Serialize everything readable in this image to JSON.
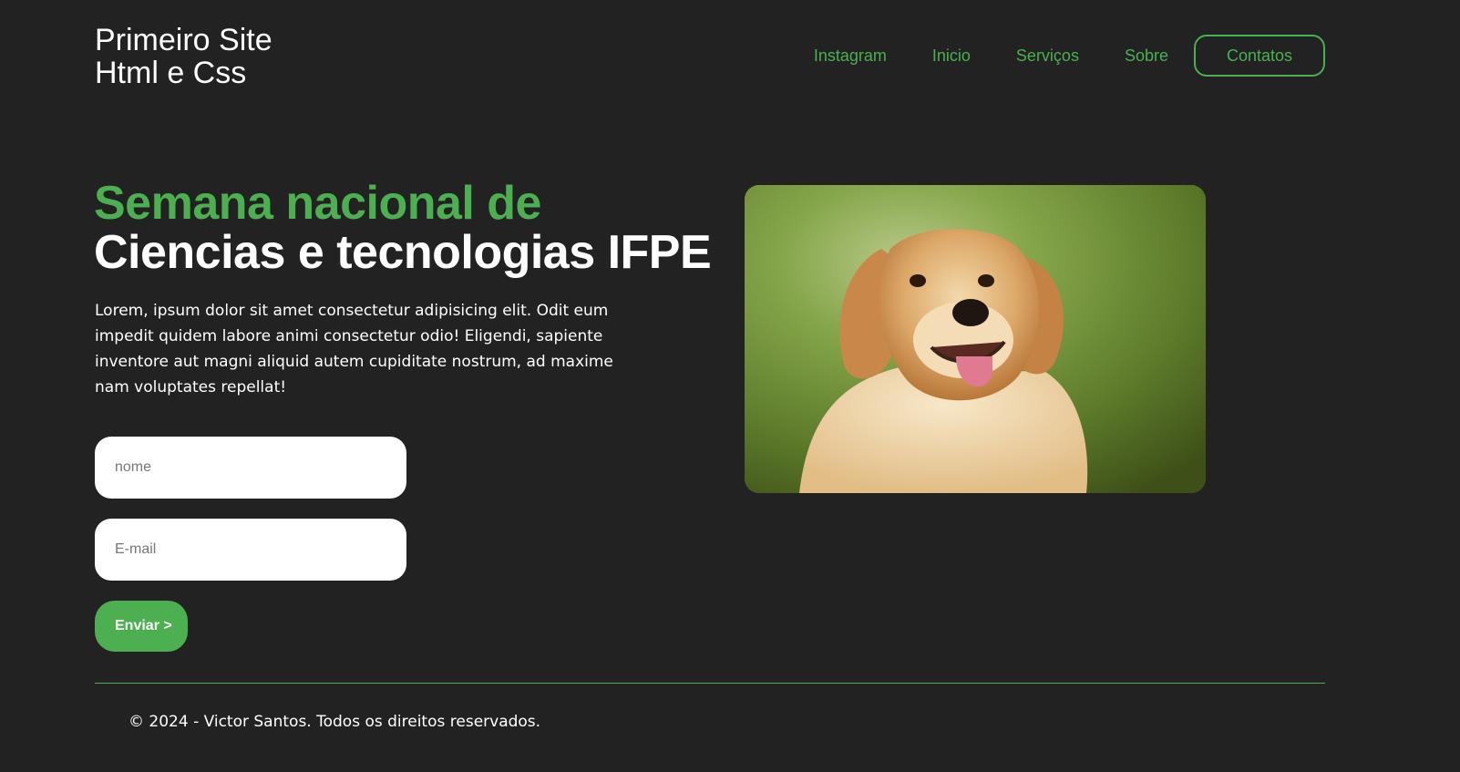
{
  "header": {
    "logo_line1": "Primeiro Site",
    "logo_line2": "Html e Css",
    "nav": [
      "Instagram",
      "Inicio",
      "Serviços",
      "Sobre"
    ],
    "contact_label": "Contatos"
  },
  "hero": {
    "title_green": "Semana nacional de",
    "title_white": "Ciencias e tecnologias IFPE",
    "description": "Lorem, ipsum dolor sit amet consectetur adipisicing elit. Odit eum impedit quidem labore animi consectetur odio! Eligendi, sapiente inventore aut magni aliquid autem cupiditate nostrum, ad maxime nam voluptates repellat!"
  },
  "form": {
    "name_placeholder": "nome",
    "email_placeholder": "E-mail",
    "submit_label": "Enviar >"
  },
  "image": {
    "subject": "golden retriever dog photo"
  },
  "footer": {
    "text": "© 2024 - Victor Santos. Todos os direitos reservados."
  },
  "colors": {
    "background": "#222222",
    "accent": "#4caf50",
    "text": "#ffffff"
  }
}
